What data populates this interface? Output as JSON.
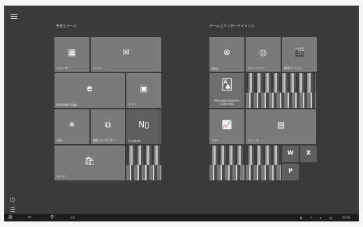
{
  "groups": {
    "left_title": "予定とメール",
    "right_title": "ゲームとエンターテイメント"
  },
  "tiles": {
    "calendar": {
      "label": "カレンダー",
      "icon": "calendar-icon"
    },
    "mail": {
      "label": "メール",
      "icon": "mail-icon"
    },
    "edge": {
      "label": "Microsoft Edge",
      "icon": "edge-icon"
    },
    "photos": {
      "label": "フォト",
      "icon": "photos-icon"
    },
    "weather": {
      "label": "天気",
      "icon": "weather-icon"
    },
    "connect": {
      "label": "電話コンパニオン",
      "icon": "phone-icon"
    },
    "onenote": {
      "label": "OneNote",
      "icon": "onenote-icon"
    },
    "store": {
      "label": "ストア",
      "icon": "store-icon"
    },
    "xbox": {
      "label": "Xbox",
      "icon": "xbox-icon"
    },
    "groove": {
      "label": "ミュージック",
      "icon": "music-icon"
    },
    "movies": {
      "label": "映画 & テレビ",
      "icon": "film-icon"
    },
    "solitaire": {
      "label": "Microsoft Solitaire Collection",
      "icon": "cards-icon"
    },
    "money": {
      "label": "マネー",
      "icon": "chart-icon"
    },
    "news": {
      "label": "ニュース",
      "icon": "news-icon"
    },
    "word": {
      "label": "W"
    },
    "excel": {
      "label": "X"
    },
    "powerpoint": {
      "label": "P"
    }
  },
  "taskbar": {
    "time": "23:59"
  }
}
